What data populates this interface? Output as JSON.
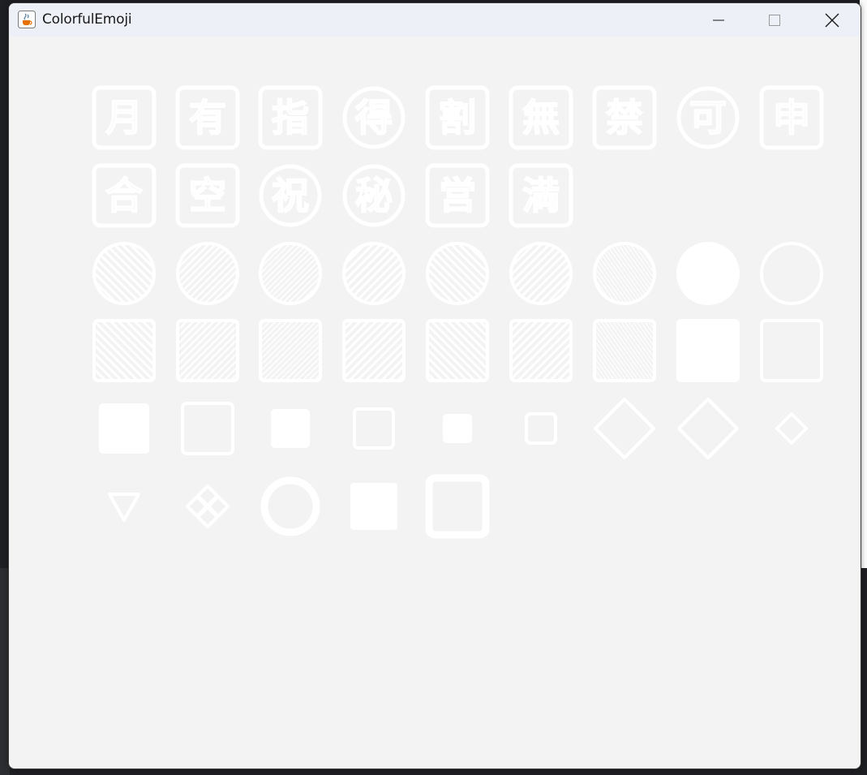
{
  "window": {
    "title": "ColorfulEmoji",
    "icon": "java-cup-icon",
    "controls": {
      "minimize": "minimize-icon",
      "maximize": "maximize-icon",
      "close": "close-icon"
    }
  },
  "emoji_color": "#ffffff",
  "background_color": "#f3f3f3",
  "rows": [
    {
      "kind": "ideograph-squares",
      "chars": [
        "月",
        "有",
        "指",
        "得",
        "割",
        "無",
        "禁",
        "可",
        "申"
      ],
      "circled": [
        false,
        false,
        false,
        true,
        false,
        false,
        false,
        true,
        false
      ]
    },
    {
      "kind": "ideograph-squares",
      "chars": [
        "合",
        "空",
        "祝",
        "秘",
        "営",
        "満"
      ],
      "circled": [
        false,
        false,
        true,
        true,
        false,
        false
      ]
    },
    {
      "kind": "large-circles",
      "items": [
        "circle-hatch-back",
        "circle-hatch-fine",
        "circle-hatch-finer",
        "circle-hatch",
        "circle-hatch-back",
        "circle-hatch",
        "circle-hatch-finest",
        "circle-filled",
        "circle-outline"
      ]
    },
    {
      "kind": "large-squares",
      "items": [
        "square-hatch-back",
        "square-hatch-fine",
        "square-hatch-finer",
        "square-hatch",
        "square-hatch-back",
        "square-hatch",
        "square-hatch-finest",
        "square-filled",
        "square-outline"
      ]
    },
    {
      "kind": "geometric",
      "items": [
        "square-medium-filled",
        "square-medium-outline",
        "square-small-filled",
        "square-small-outline",
        "square-xsmall-filled",
        "square-xsmall-outline",
        "diamond-large-outline",
        "diamond-large-outline",
        "diamond-small-outline"
      ]
    },
    {
      "kind": "misc",
      "items": [
        "triangle-down-outline",
        "diamond-flower",
        "ring-circle",
        "square-filled",
        "square-thick-outline"
      ]
    }
  ]
}
